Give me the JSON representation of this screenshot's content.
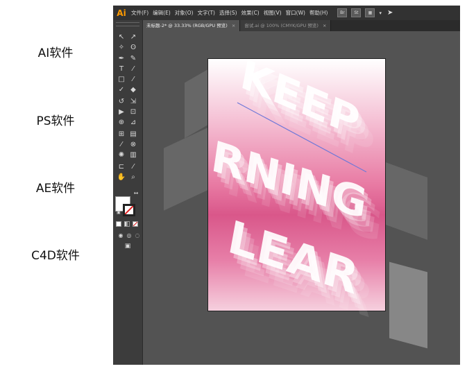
{
  "labels": [
    "AI软件",
    "PS软件",
    "AE软件",
    "C4D软件"
  ],
  "app": {
    "logo": "Ai",
    "menu": [
      "文件(F)",
      "编辑(E)",
      "对象(O)",
      "文字(T)",
      "选择(S)",
      "效果(C)",
      "视图(V)",
      "窗口(W)",
      "帮助(H)"
    ],
    "menu_right": [
      "Br",
      "St"
    ],
    "tabs": [
      {
        "label": "未标题-2* @ 33.33% (RGB/GPU 预览)",
        "close": "×"
      },
      {
        "label": "尝试.ai @ 100% (CMYK/GPU 预览)",
        "close": "×"
      }
    ]
  },
  "artwork": {
    "lines": [
      "KEEP",
      "RNING",
      "LEAR"
    ]
  },
  "colors": {
    "menubar": "#323232",
    "toolbar": "#3c3c3c",
    "canvas": "#535353",
    "logo": "#ff9a00",
    "pink": "#d9578a"
  },
  "icons": [
    "selection-icon",
    "direct-selection-icon",
    "magic-wand-icon",
    "lasso-icon",
    "pen-icon",
    "curvature-icon",
    "type-icon",
    "line-icon",
    "rectangle-icon",
    "paintbrush-icon",
    "shaper-icon",
    "eraser-icon",
    "rotate-icon",
    "scale-icon",
    "width-icon",
    "free-transform-icon",
    "shape-builder-icon",
    "perspective-icon",
    "mesh-icon",
    "gradient-icon",
    "eyedropper-icon",
    "blend-icon",
    "symbol-sprayer-icon",
    "graph-icon",
    "artboard-icon",
    "slice-icon",
    "hand-icon",
    "zoom-icon"
  ]
}
